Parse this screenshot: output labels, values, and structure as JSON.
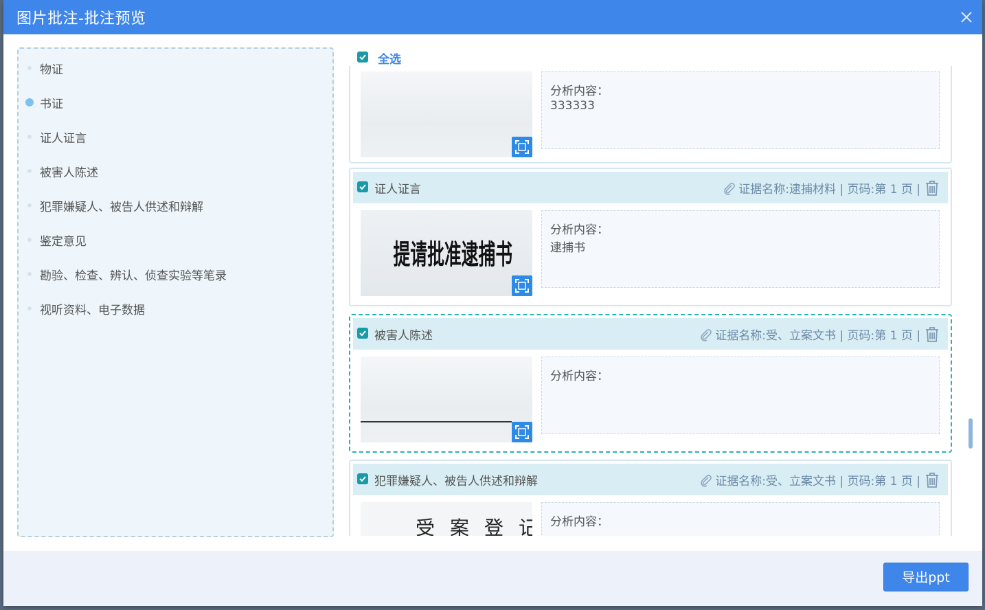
{
  "dialog": {
    "title": "图片批注-批注预览",
    "close_icon": "close-icon"
  },
  "sidebar": {
    "items": [
      {
        "label": "物证",
        "active": false
      },
      {
        "label": "书证",
        "active": true
      },
      {
        "label": "证人证言",
        "active": false
      },
      {
        "label": "被害人陈述",
        "active": false
      },
      {
        "label": "犯罪嫌疑人、被告人供述和辩解",
        "active": false
      },
      {
        "label": "鉴定意见",
        "active": false
      },
      {
        "label": "勘验、检查、辨认、侦查实验等笔录",
        "active": false
      },
      {
        "label": "视听资料、电子数据",
        "active": false
      }
    ]
  },
  "select_all": {
    "label": "全选",
    "checked": true
  },
  "cards": [
    {
      "type": "",
      "meta": "",
      "analysis_label": "分析内容：",
      "analysis_value": "333333",
      "thumb_text": "",
      "selected": false
    },
    {
      "type": "证人证言",
      "meta": "证据名称:逮捕材料 | 页码:第 1 页 |",
      "analysis_label": "分析内容：",
      "analysis_value": "逮捕书",
      "thumb_text": "提请批准逮捕书",
      "selected": false
    },
    {
      "type": "被害人陈述",
      "meta": "证据名称:受、立案文书 | 页码:第 1 页 |",
      "analysis_label": "分析内容：",
      "analysis_value": "",
      "thumb_text": "",
      "selected": true
    },
    {
      "type": "犯罪嫌疑人、被告人供述和辩解",
      "meta": "证据名称:受、立案文书 | 页码:第 1 页 |",
      "analysis_label": "分析内容：",
      "analysis_value": "",
      "thumb_text": "受案登记",
      "selected": false
    }
  ],
  "footer": {
    "export_label": "导出ppt"
  },
  "colors": {
    "header_bg": "#3f86ea",
    "accent_teal": "#1a9aa6",
    "selected_border": "#25b3b0",
    "card_header_bg": "#d9eef4"
  }
}
